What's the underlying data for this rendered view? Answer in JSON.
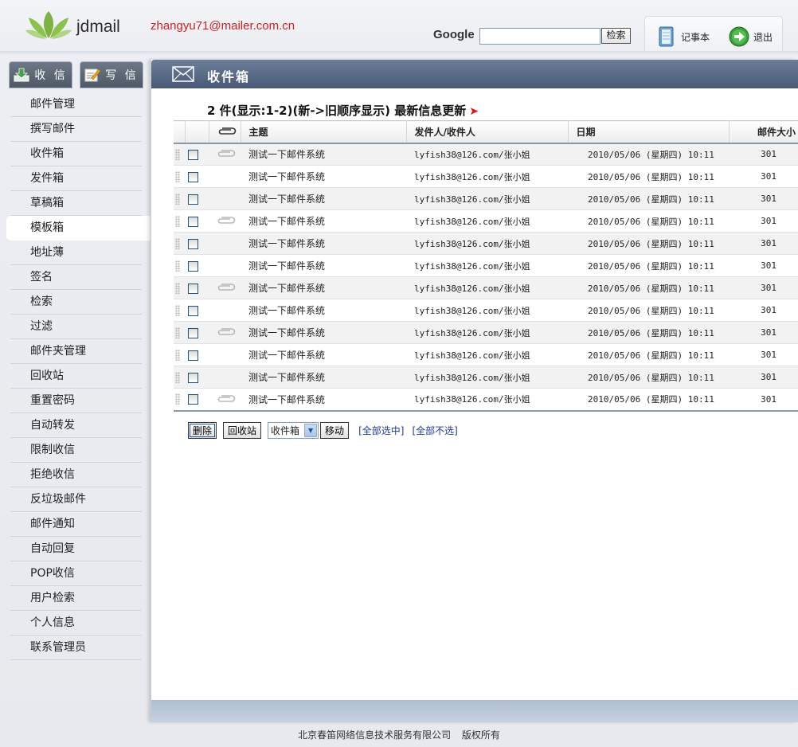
{
  "header": {
    "logo_text": "jdmail",
    "user_email": "zhangyu71@mailer.com.cn",
    "google_label": "Google",
    "google_input_value": "",
    "search_button": "检索",
    "notepad_label": "记事本",
    "logout_label": "退出"
  },
  "sidebar": {
    "receive_tab": "收 信",
    "write_tab": "写 信",
    "items": [
      "邮件管理",
      "撰写邮件",
      "收件箱",
      "发件箱",
      "草稿箱",
      "模板箱",
      "地址薄",
      "签名",
      "检索",
      "过滤",
      "邮件夹管理",
      "回收站",
      "重置密码",
      "自动转发",
      "限制收信",
      "拒绝收信",
      "反垃圾邮件",
      "邮件通知",
      "自动回复",
      "POP收信",
      "用户检索",
      "个人信息",
      "联系管理员"
    ],
    "active_item": "模板箱"
  },
  "main": {
    "title": "收件箱",
    "summary": "2 件(显示:1-2)(新->旧顺序显示) 最新信息更新",
    "columns": {
      "subject": "主题",
      "from": "发件人/收件人",
      "date": "日期",
      "size": "邮件大小"
    },
    "rows": [
      {
        "attach": true,
        "subject": "测试一下邮件系统",
        "from": "lyfish38@126.com/张小姐",
        "date": "2010/05/06 (星期四) 10:11",
        "size": "301"
      },
      {
        "attach": false,
        "subject": "测试一下邮件系统",
        "from": "lyfish38@126.com/张小姐",
        "date": "2010/05/06 (星期四) 10:11",
        "size": "301"
      },
      {
        "attach": false,
        "subject": "测试一下邮件系统",
        "from": "lyfish38@126.com/张小姐",
        "date": "2010/05/06 (星期四) 10:11",
        "size": "301"
      },
      {
        "attach": true,
        "subject": "测试一下邮件系统",
        "from": "lyfish38@126.com/张小姐",
        "date": "2010/05/06 (星期四) 10:11",
        "size": "301"
      },
      {
        "attach": false,
        "subject": "测试一下邮件系统",
        "from": "lyfish38@126.com/张小姐",
        "date": "2010/05/06 (星期四) 10:11",
        "size": "301"
      },
      {
        "attach": false,
        "subject": "测试一下邮件系统",
        "from": "lyfish38@126.com/张小姐",
        "date": "2010/05/06 (星期四) 10:11",
        "size": "301"
      },
      {
        "attach": true,
        "subject": "测试一下邮件系统",
        "from": "lyfish38@126.com/张小姐",
        "date": "2010/05/06 (星期四) 10:11",
        "size": "301"
      },
      {
        "attach": false,
        "subject": "测试一下邮件系统",
        "from": "lyfish38@126.com/张小姐",
        "date": "2010/05/06 (星期四) 10:11",
        "size": "301"
      },
      {
        "attach": true,
        "subject": "测试一下邮件系统",
        "from": "lyfish38@126.com/张小姐",
        "date": "2010/05/06 (星期四) 10:11",
        "size": "301"
      },
      {
        "attach": false,
        "subject": "测试一下邮件系统",
        "from": "lyfish38@126.com/张小姐",
        "date": "2010/05/06 (星期四) 10:11",
        "size": "301"
      },
      {
        "attach": false,
        "subject": "测试一下邮件系统",
        "from": "lyfish38@126.com/张小姐",
        "date": "2010/05/06 (星期四) 10:11",
        "size": "301"
      },
      {
        "attach": true,
        "subject": "测试一下邮件系统",
        "from": "lyfish38@126.com/张小姐",
        "date": "2010/05/06 (星期四) 10:11",
        "size": "301"
      }
    ],
    "actions": {
      "delete": "删除",
      "recycle": "回收站",
      "folder_selected": "收件箱",
      "move": "移动",
      "select_all": "[全部选中]",
      "deselect_all": "[全部不选]"
    }
  },
  "footer": {
    "company": "北京春笛网络信息技术服务有限公司",
    "rights": "版权所有"
  },
  "colors": {
    "email": "#d22020",
    "header_bar": "#5a6b87",
    "link": "#1e3a9e",
    "arrow": "#e11111"
  }
}
